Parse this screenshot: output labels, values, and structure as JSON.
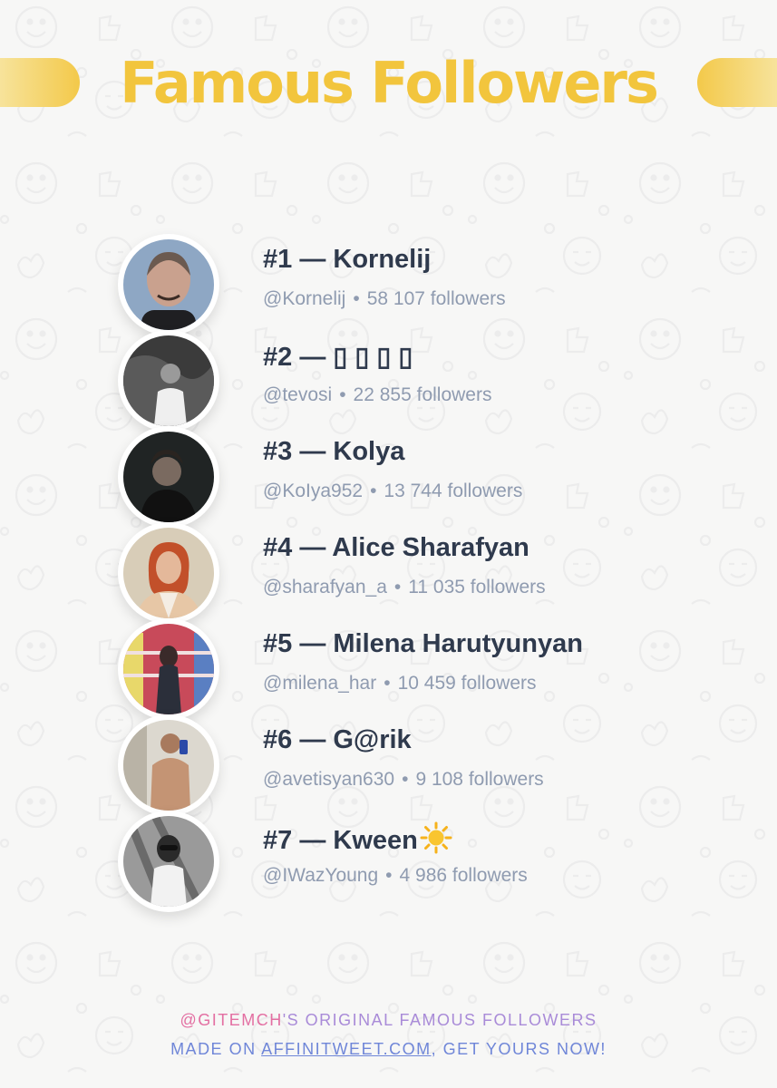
{
  "title": "Famous Followers",
  "colors": {
    "accent_yellow": "#f2c53d",
    "name_text": "#2f3a4d",
    "meta_text": "#8f9bb0",
    "footer_handle": "#e36fa2",
    "footer_purple": "#a98bd8",
    "footer_blue": "#6f86d8"
  },
  "followers": [
    {
      "rank_name": "#1 — Kornelij",
      "handle": "@Kornelij",
      "followers": "58 107 followers"
    },
    {
      "rank_name": "#2 — ▯ ▯ ▯ ▯",
      "handle": "@tevosi",
      "followers": "22 855 followers"
    },
    {
      "rank_name": "#3 — Kolya",
      "handle": "@KoIya952",
      "followers": "13 744 followers"
    },
    {
      "rank_name": "#4 — Alice Sharafyan",
      "handle": "@sharafyan_a",
      "followers": "11 035 followers"
    },
    {
      "rank_name": "#5 — Milena Harutyunyan",
      "handle": "@milena_har",
      "followers": "10 459 followers"
    },
    {
      "rank_name": "#6 — G@rik",
      "handle": "@avetisyan630",
      "followers": "9 108 followers"
    },
    {
      "rank_name": "#7 — Kween",
      "handle": "@IWazYoung",
      "followers": "4 986 followers",
      "name_icon": "sun-emoji-icon"
    }
  ],
  "separator": "•",
  "footer": {
    "handle": "@GITEMCH",
    "line1_rest": "'S ORIGINAL FAMOUS FOLLOWERS",
    "line2_prefix": "MADE ON ",
    "link": "AFFINITWEET.COM",
    "line2_suffix": ", GET YOURS NOW!"
  }
}
